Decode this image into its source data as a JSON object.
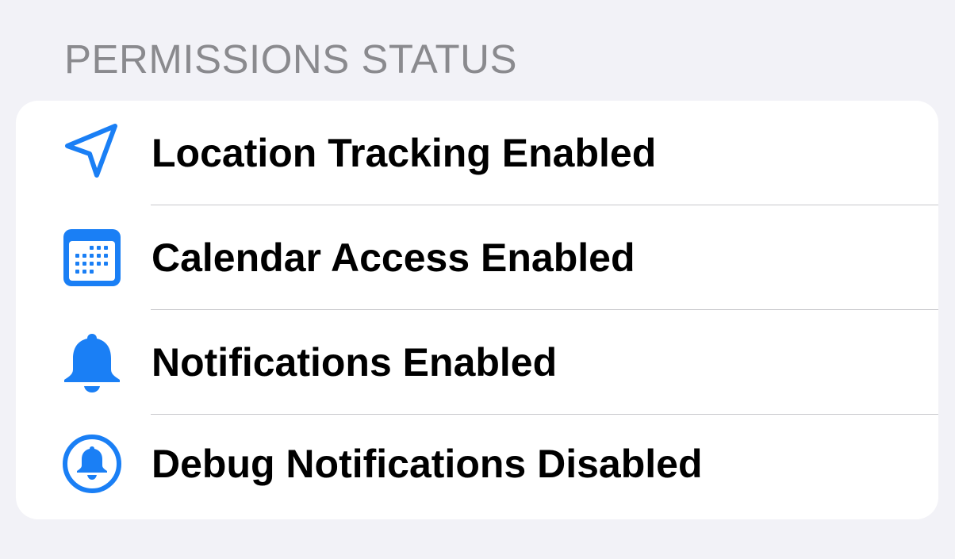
{
  "header": {
    "title": "PERMISSIONS STATUS"
  },
  "accent_color": "#1a7ff5",
  "permissions": [
    {
      "label": "Location Tracking Enabled",
      "icon": "location-arrow-icon"
    },
    {
      "label": "Calendar Access Enabled",
      "icon": "calendar-icon"
    },
    {
      "label": "Notifications Enabled",
      "icon": "bell-icon"
    },
    {
      "label": "Debug Notifications Disabled",
      "icon": "bell-circle-icon"
    }
  ]
}
